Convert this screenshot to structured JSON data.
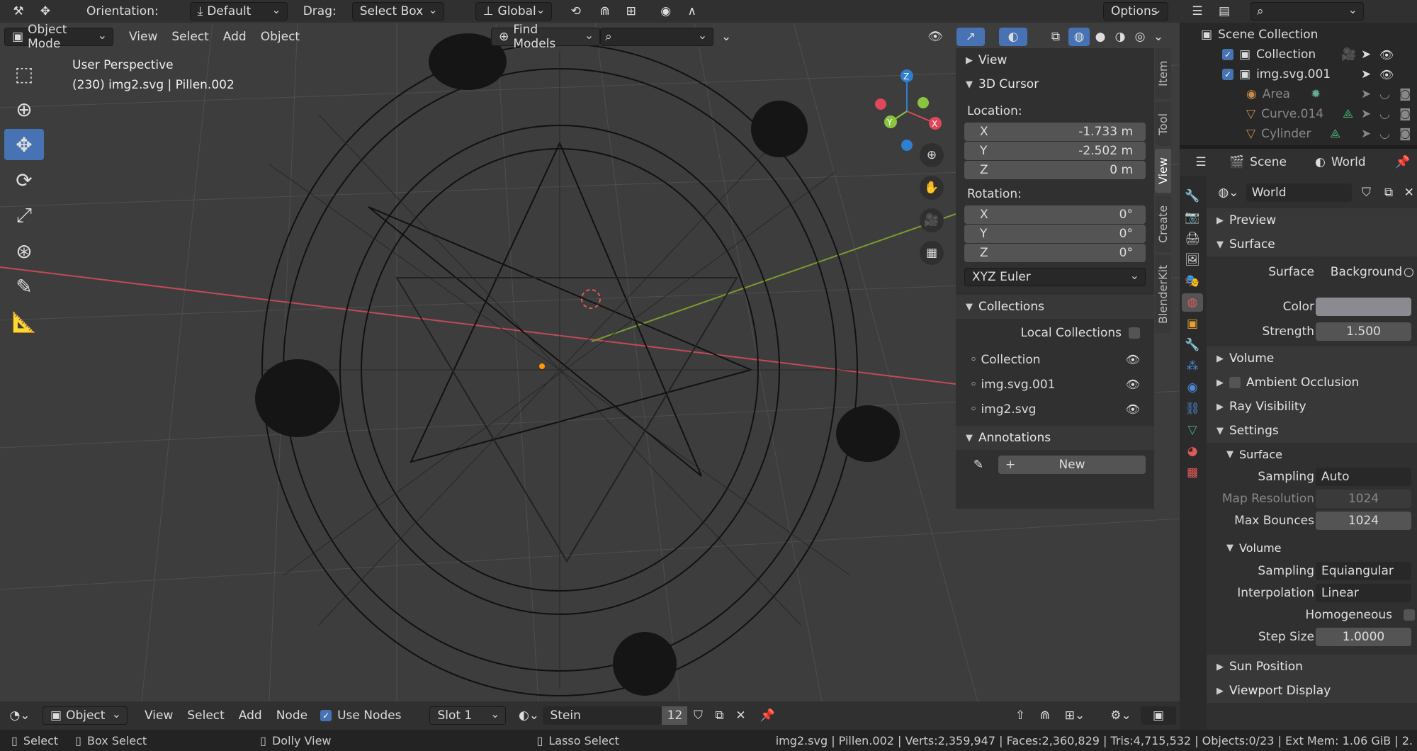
{
  "topbar": {
    "orientation_label": "Orientation:",
    "orientation_value": "Default",
    "drag_label": "Drag:",
    "drag_value": "Select Box",
    "transform_value": "Global",
    "options": "Options"
  },
  "header": {
    "mode": "Object Mode",
    "menus": [
      "View",
      "Select",
      "Add",
      "Object"
    ],
    "find_models": "Find Models"
  },
  "viewport": {
    "perspective": "User Perspective",
    "object_info": "(230) img2.svg | Pillen.002",
    "gizmo_axes": {
      "x": "X",
      "y": "Y",
      "z": "Z"
    }
  },
  "npanel": {
    "tabs": [
      "Item",
      "Tool",
      "View",
      "Create",
      "BlenderKit"
    ],
    "view_section": "View",
    "cursor_section": "3D Cursor",
    "location_label": "Location:",
    "location": [
      {
        "axis": "X",
        "value": "-1.733 m"
      },
      {
        "axis": "Y",
        "value": "-2.502 m"
      },
      {
        "axis": "Z",
        "value": "0 m"
      }
    ],
    "rotation_label": "Rotation:",
    "rotation": [
      {
        "axis": "X",
        "value": "0°"
      },
      {
        "axis": "Y",
        "value": "0°"
      },
      {
        "axis": "Z",
        "value": "0°"
      }
    ],
    "rotation_mode": "XYZ Euler",
    "collections_section": "Collections",
    "local_collections": "Local Collections",
    "collections": [
      "Collection",
      "img.svg.001",
      "img2.svg"
    ],
    "annotations_section": "Annotations",
    "new_button": "New"
  },
  "outliner": {
    "root": "Scene Collection",
    "items": [
      {
        "name": "Collection",
        "dim": false
      },
      {
        "name": "img.svg.001",
        "dim": false
      },
      {
        "name": "Area",
        "dim": true
      },
      {
        "name": "Curve.014",
        "dim": true
      },
      {
        "name": "Cylinder",
        "dim": true
      }
    ]
  },
  "properties": {
    "scene_tab": "Scene",
    "world_tab": "World",
    "world_name": "World",
    "preview": "Preview",
    "surface_panel": "Surface",
    "surface_label": "Surface",
    "surface_value": "Background",
    "color_label": "Color",
    "color_value": "#8a8a90",
    "strength_label": "Strength",
    "strength_value": "1.500",
    "volume_panel": "Volume",
    "ambient_occlusion": "Ambient Occlusion",
    "ray_visibility": "Ray Visibility",
    "settings_panel": "Settings",
    "settings_surface": "Surface",
    "sampling_label": "Sampling",
    "sampling_value": "Auto",
    "map_resolution_label": "Map Resolution",
    "map_resolution_value": "1024",
    "max_bounces_label": "Max Bounces",
    "max_bounces_value": "1024",
    "settings_volume": "Volume",
    "vol_sampling_label": "Sampling",
    "vol_sampling_value": "Equiangular",
    "interpolation_label": "Interpolation",
    "interpolation_value": "Linear",
    "homogeneous_label": "Homogeneous",
    "step_size_label": "Step Size",
    "step_size_value": "1.0000",
    "sun_position": "Sun Position",
    "viewport_display": "Viewport Display"
  },
  "bottombar": {
    "editor": "Object",
    "menus": [
      "View",
      "Select",
      "Add",
      "Node"
    ],
    "use_nodes": "Use Nodes",
    "slot": "Slot 1",
    "material": "Stein",
    "users": "12"
  },
  "statusbar": {
    "select": "Select",
    "box_select": "Box Select",
    "dolly_view": "Dolly View",
    "lasso_select": "Lasso Select",
    "stats": "img2.svg | Pillen.002 | Verts:2,359,947 | Faces:2,360,829 | Tris:4,715,532 | Objects:0/23 | Ext Mem: 1.06 GiB | 2."
  },
  "colors": {
    "accent": "#4772b3",
    "x_axis": "#e0475a",
    "y_axis": "#8bc53f",
    "z_axis": "#2f7fd1"
  }
}
